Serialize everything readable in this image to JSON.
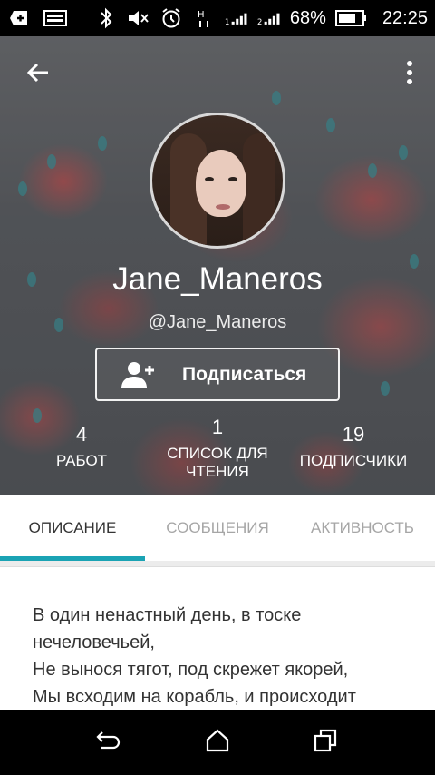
{
  "status_bar": {
    "battery_percent": "68%",
    "time": "22:25",
    "sim1_label": "1",
    "sim2_label": "2",
    "icons": [
      "add-box-icon",
      "image-icon",
      "bluetooth-icon",
      "mute-icon",
      "alarm-icon",
      "signal-icon",
      "battery-icon"
    ]
  },
  "header": {
    "back_icon": "arrow-back-icon",
    "more_icon": "more-vertical-icon"
  },
  "profile": {
    "display_name": "Jane_Maneros",
    "handle": "@Jane_Maneros",
    "follow_button_label": "Подписаться",
    "follow_icon": "add-person-icon"
  },
  "stats": [
    {
      "value": "4",
      "label": "РАБОТ"
    },
    {
      "value": "1",
      "label": "СПИСОК ДЛЯ\nЧТЕНИЯ"
    },
    {
      "value": "19",
      "label": "ПОДПИСЧИКИ"
    }
  ],
  "tabs": [
    {
      "label": "ОПИСАНИЕ",
      "active": true
    },
    {
      "label": "СООБЩЕНИЯ",
      "active": false
    },
    {
      "label": "АКТИВНОСТЬ",
      "active": false
    }
  ],
  "description": {
    "text": "В один ненастный день, в тоске\nнечеловечьей,\nНе вынося тягот, под скрежет якорей,\nМы всходим на корабль, и происходит"
  },
  "colors": {
    "accent": "#1aa3b4",
    "tab_inactive": "#a6a6a6",
    "tab_active": "#333333"
  }
}
